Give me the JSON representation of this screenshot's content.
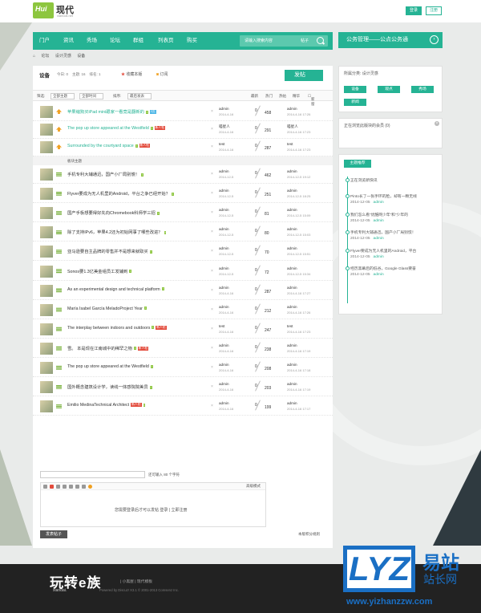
{
  "header": {
    "logo_text": "Hui",
    "logo_sub": "xiandai",
    "site_name": "现代",
    "site_sub": "xianDai.net",
    "login": "登录",
    "register": "注册"
  },
  "nav": {
    "items": [
      "门户",
      "资讯",
      "秀场",
      "论坛",
      "群组",
      "列表页",
      "购买"
    ],
    "search_placeholder": "请输入搜索内容",
    "search_option": "帖子"
  },
  "breadcrumb": [
    "论坛",
    "设计灵感",
    "设备"
  ],
  "forum": {
    "name": "设备",
    "stats": [
      "今日: 0",
      "主题: 16",
      "排名: 1"
    ],
    "favorite": "收藏本版",
    "rss": "订阅",
    "post_label": "发帖",
    "back_label": "返回",
    "filter": {
      "label": "筛选:",
      "all_topics": "全部主题",
      "all_time": "全部时间",
      "sort_label": "排序:",
      "sort_value": "最后发表"
    },
    "headers": {
      "latest": "最新",
      "hot": "热门",
      "digest": "热帖",
      "sort": "精华",
      "switch": "新窗"
    },
    "section_label": "板块主题",
    "sticky": [
      {
        "title": "苹果缩狗买iPad mini跟家一看竟是翻新的",
        "author": "admin",
        "date": "2014-4-16",
        "replies": "0",
        "views": "458",
        "last_user": "admin",
        "last_date": "2014-4-16 17:26",
        "badges": [
          "i",
          "d"
        ]
      },
      {
        "title": "The pop up store appeared at the Westfield",
        "author": "喵星人",
        "date": "2014-4-16",
        "replies": "0",
        "views": "291",
        "last_user": "喵星人",
        "last_date": "2014-4-16 17:23",
        "badges": [
          "i",
          "h"
        ]
      },
      {
        "title": "Surrounded by the courtyard space",
        "author": "test",
        "date": "2014-4-16",
        "replies": "0",
        "views": "287",
        "last_user": "test",
        "last_date": "2014-4-16 17:23",
        "badges": [
          "i",
          "h"
        ]
      }
    ],
    "threads": [
      {
        "title": "手机专利大辅通迅，国产小厂局别慌！",
        "author": "admin",
        "date": "2014-12-5",
        "replies": "0",
        "views": "462",
        "last_user": "admin",
        "last_date": "2014-12-5 19:12",
        "badges": [
          "i"
        ]
      },
      {
        "title": "Flyver要成为无人机里的Android，平台之争已经开始？",
        "author": "admin",
        "date": "2014-12-5",
        "replies": "0",
        "views": "251",
        "last_user": "admin",
        "last_date": "2014-12-5 18:25",
        "badges": [
          "i"
        ]
      },
      {
        "title": "国产手板想要得好先向Chromebook科师学三招",
        "author": "admin",
        "date": "2014-12-5",
        "replies": "0",
        "views": "81",
        "last_user": "admin",
        "last_date": "2014-12-5 15:09",
        "badges": [
          "i"
        ]
      },
      {
        "title": "除了支持IPv6，苹果4.2还为初始网事了哪些改进？",
        "author": "admin",
        "date": "2014-12-5",
        "replies": "0",
        "views": "80",
        "last_user": "admin",
        "last_date": "2014-12-5 15:03",
        "badges": [
          "i"
        ]
      },
      {
        "title": "亚马逊要自主品牌的零售并不是想来就取买",
        "author": "admin",
        "date": "2014-12-5",
        "replies": "0",
        "views": "70",
        "last_user": "admin",
        "last_date": "2014-12-5 15:51",
        "badges": [
          "i"
        ]
      },
      {
        "title": "Sonos要1.3亿美金组员工发辅到",
        "author": "admin",
        "date": "2014-12-5",
        "replies": "0",
        "views": "72",
        "last_user": "admin",
        "last_date": "2014-12-5 15:34",
        "badges": [
          "i"
        ]
      },
      {
        "title": "As an experimental design and technical platform",
        "author": "admin",
        "date": "2014-4-16",
        "replies": "0",
        "views": "287",
        "last_user": "admin",
        "last_date": "2014-4-16 17:27",
        "badges": [
          "i"
        ]
      },
      {
        "title": "María Isabel García MeladoProject Year",
        "author": "admin",
        "date": "2014-4-16",
        "replies": "0",
        "views": "212",
        "last_user": "admin",
        "last_date": "2014-4-16 17:26",
        "badges": [
          "i"
        ]
      },
      {
        "title": "The interplay between indoors and outdoors",
        "author": "test",
        "date": "2014-4-16",
        "replies": "0",
        "views": "247",
        "last_user": "test",
        "last_date": "2014-4-16 17:23",
        "badges": [
          "i",
          "h"
        ]
      },
      {
        "title": "雪。 本是现在江南城中的稀罕之物",
        "author": "admin",
        "date": "2014-4-16",
        "replies": "0",
        "views": "238",
        "last_user": "admin",
        "last_date": "2014-4-16 17:19",
        "badges": [
          "i",
          "h"
        ]
      },
      {
        "title": "The pop up store appeared at the Westfield",
        "author": "admin",
        "date": "2014-4-16",
        "replies": "0",
        "views": "208",
        "last_user": "admin",
        "last_date": "2014-4-16 17:18",
        "badges": [
          "i"
        ]
      },
      {
        "title": "国外概念建筑设计学，读线一体感院院美员",
        "author": "admin",
        "date": "2014-4-16",
        "replies": "0",
        "views": "203",
        "last_user": "admin",
        "last_date": "2014-4-16 17:19",
        "badges": [
          "i"
        ]
      },
      {
        "title": "Emilio MedinaTechnical Architect",
        "author": "admin",
        "date": "2014-4-16",
        "replies": "0",
        "views": "199",
        "last_user": "admin",
        "last_date": "2014-4-16 17:17",
        "badges": [
          "h",
          "i"
        ]
      }
    ]
  },
  "reply": {
    "tip": "还可输入 80 个字符",
    "advanced": "高级模式",
    "need_login": "您需要登录后才可以发帖 登录 | 立即注册",
    "submit": "发表帖子",
    "rules": "本版积分规则"
  },
  "sidebar": {
    "banner": "公务管理——公点公务通",
    "category_label": "所属分类: 设计灵感",
    "tags": [
      "设备",
      "观点",
      "秀场",
      "新闻"
    ],
    "viewing": "正在浏览此版块的会员 (0)",
    "hot_tab": "主题推荐",
    "hot_head": "正在浏览新快讯",
    "hot_items": [
      {
        "title": "Pinto长了一张手环的脸，却有一颗无线",
        "date": "2014-12-05",
        "user": "admin"
      },
      {
        "title": "我们怎么看“优酷网少年”和“少年的",
        "date": "2014-12-05",
        "user": "admin"
      },
      {
        "title": "手机专利大辅通迅，国产小厂局别慌！",
        "date": "2014-12-05",
        "user": "admin"
      },
      {
        "title": "Flyver要成为无人机里的Android，平台",
        "date": "2014-12-05",
        "user": "admin"
      },
      {
        "title": "经历黑幕后的低谷，Google Glass要奋",
        "date": "2014-12-05",
        "user": "admin"
      }
    ]
  },
  "footer": {
    "brand": "玩转e族",
    "sub": "xiandai.",
    "links": "| 小黑屋 | 现代模板",
    "copyright": "Powered by Discuz! X3.1 © 2001-2013 Comsenz Inc."
  },
  "watermark": {
    "logo": "LYZ",
    "cn1": "易站",
    "cn2": "站长网",
    "url": "www.yizhanzzw.com"
  }
}
